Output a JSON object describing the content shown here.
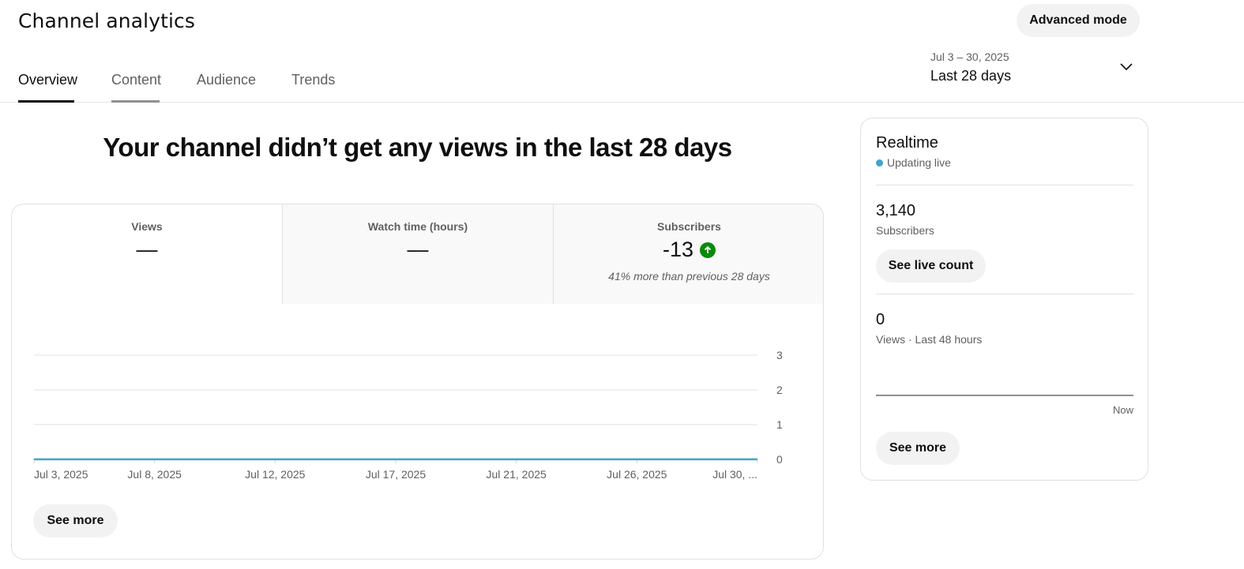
{
  "header": {
    "title": "Channel analytics",
    "advanced_mode_label": "Advanced mode"
  },
  "tabs": [
    {
      "label": "Overview",
      "active": true
    },
    {
      "label": "Content",
      "active": false
    },
    {
      "label": "Audience",
      "active": false
    },
    {
      "label": "Trends",
      "active": false
    }
  ],
  "date_range": {
    "range_text": "Jul 3 – 30, 2025",
    "period_label": "Last 28 days",
    "icon": "chevron-down-icon"
  },
  "headline": "Your channel didn’t get any views in the last 28 days",
  "metrics": [
    {
      "label": "Views",
      "value": "—",
      "note": ""
    },
    {
      "label": "Watch time (hours)",
      "value": "—",
      "note": ""
    },
    {
      "label": "Subscribers",
      "value": "-13",
      "note": "41% more than previous 28 days",
      "trend_icon": "arrow-up-icon",
      "trend_color": "#0a8a0a"
    }
  ],
  "chart_data": {
    "type": "line",
    "x": [
      "Jul 3, 2025",
      "Jul 8, 2025",
      "Jul 12, 2025",
      "Jul 17, 2025",
      "Jul 21, 2025",
      "Jul 26, 2025",
      "Jul 30, ..."
    ],
    "series": [
      {
        "values": [
          0,
          0,
          0,
          0,
          0,
          0,
          0
        ],
        "color": "#3ea6c8"
      }
    ],
    "y_ticks": [
      "0",
      "1",
      "2",
      "3"
    ],
    "ylim": [
      0,
      3
    ],
    "grid": true,
    "y_axis_position": "right"
  },
  "overview_see_more_label": "See more",
  "realtime": {
    "title": "Realtime",
    "status": "Updating live",
    "status_color": "#3ea6c8",
    "subscribers_value": "3,140",
    "subscribers_label": "Subscribers",
    "live_count_label": "See live count",
    "views_value": "0",
    "views_label": "Views · Last 48 hours",
    "axis_end_label": "Now",
    "see_more_label": "See more"
  }
}
